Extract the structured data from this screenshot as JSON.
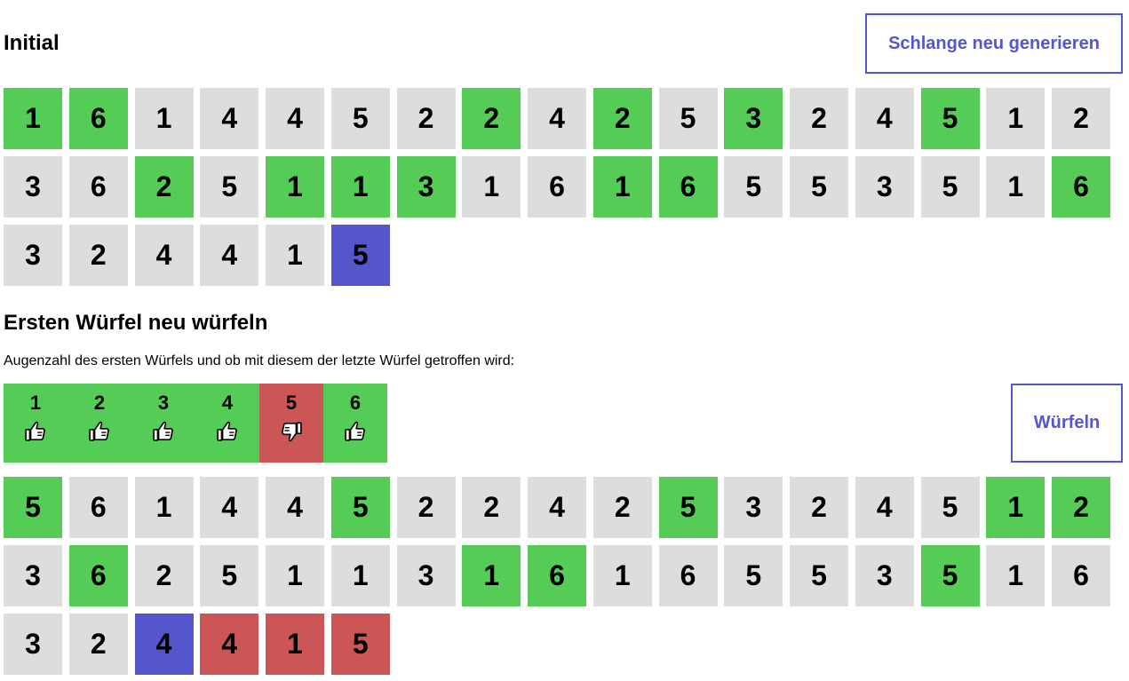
{
  "section1": {
    "title": "Initial",
    "regenerate_label": "Schlange neu generieren",
    "dice": [
      {
        "v": "1",
        "s": "hit"
      },
      {
        "v": "6",
        "s": "hit"
      },
      {
        "v": "1",
        "s": ""
      },
      {
        "v": "4",
        "s": ""
      },
      {
        "v": "4",
        "s": ""
      },
      {
        "v": "5",
        "s": ""
      },
      {
        "v": "2",
        "s": ""
      },
      {
        "v": "2",
        "s": "hit"
      },
      {
        "v": "4",
        "s": ""
      },
      {
        "v": "2",
        "s": "hit"
      },
      {
        "v": "5",
        "s": ""
      },
      {
        "v": "3",
        "s": "hit"
      },
      {
        "v": "2",
        "s": ""
      },
      {
        "v": "4",
        "s": ""
      },
      {
        "v": "5",
        "s": "hit"
      },
      {
        "v": "1",
        "s": ""
      },
      {
        "v": "2",
        "s": ""
      },
      {
        "v": "3",
        "s": ""
      },
      {
        "v": "6",
        "s": ""
      },
      {
        "v": "2",
        "s": "hit"
      },
      {
        "v": "5",
        "s": ""
      },
      {
        "v": "1",
        "s": "hit"
      },
      {
        "v": "1",
        "s": "hit"
      },
      {
        "v": "3",
        "s": "hit"
      },
      {
        "v": "1",
        "s": ""
      },
      {
        "v": "6",
        "s": ""
      },
      {
        "v": "1",
        "s": "hit"
      },
      {
        "v": "6",
        "s": "hit"
      },
      {
        "v": "5",
        "s": ""
      },
      {
        "v": "5",
        "s": ""
      },
      {
        "v": "3",
        "s": ""
      },
      {
        "v": "5",
        "s": ""
      },
      {
        "v": "1",
        "s": ""
      },
      {
        "v": "6",
        "s": "hit"
      },
      {
        "v": "3",
        "s": ""
      },
      {
        "v": "2",
        "s": ""
      },
      {
        "v": "4",
        "s": ""
      },
      {
        "v": "4",
        "s": ""
      },
      {
        "v": "1",
        "s": ""
      },
      {
        "v": "5",
        "s": "cur"
      }
    ]
  },
  "section2": {
    "title": "Ersten Würfel neu würfeln",
    "description": "Augenzahl des ersten Würfels und ob mit diesem der letzte Würfel getroffen wird:",
    "roll_label": "Würfeln",
    "options": [
      {
        "num": "1",
        "result": "thumbs-up"
      },
      {
        "num": "2",
        "result": "thumbs-up"
      },
      {
        "num": "3",
        "result": "thumbs-up"
      },
      {
        "num": "4",
        "result": "thumbs-up"
      },
      {
        "num": "5",
        "result": "thumbs-down"
      },
      {
        "num": "6",
        "result": "thumbs-up"
      }
    ],
    "dice": [
      {
        "v": "5",
        "s": "hit"
      },
      {
        "v": "6",
        "s": ""
      },
      {
        "v": "1",
        "s": ""
      },
      {
        "v": "4",
        "s": ""
      },
      {
        "v": "4",
        "s": ""
      },
      {
        "v": "5",
        "s": "hit"
      },
      {
        "v": "2",
        "s": ""
      },
      {
        "v": "2",
        "s": ""
      },
      {
        "v": "4",
        "s": ""
      },
      {
        "v": "2",
        "s": ""
      },
      {
        "v": "5",
        "s": "hit"
      },
      {
        "v": "3",
        "s": ""
      },
      {
        "v": "2",
        "s": ""
      },
      {
        "v": "4",
        "s": ""
      },
      {
        "v": "5",
        "s": ""
      },
      {
        "v": "1",
        "s": "hit"
      },
      {
        "v": "2",
        "s": "hit"
      },
      {
        "v": "3",
        "s": ""
      },
      {
        "v": "6",
        "s": "hit"
      },
      {
        "v": "2",
        "s": ""
      },
      {
        "v": "5",
        "s": ""
      },
      {
        "v": "1",
        "s": ""
      },
      {
        "v": "1",
        "s": ""
      },
      {
        "v": "3",
        "s": ""
      },
      {
        "v": "1",
        "s": "hit"
      },
      {
        "v": "6",
        "s": "hit"
      },
      {
        "v": "1",
        "s": ""
      },
      {
        "v": "6",
        "s": ""
      },
      {
        "v": "5",
        "s": ""
      },
      {
        "v": "5",
        "s": ""
      },
      {
        "v": "3",
        "s": ""
      },
      {
        "v": "5",
        "s": "hit"
      },
      {
        "v": "1",
        "s": ""
      },
      {
        "v": "6",
        "s": ""
      },
      {
        "v": "3",
        "s": ""
      },
      {
        "v": "2",
        "s": ""
      },
      {
        "v": "4",
        "s": "cur"
      },
      {
        "v": "4",
        "s": "miss"
      },
      {
        "v": "1",
        "s": "miss"
      },
      {
        "v": "5",
        "s": "miss"
      }
    ]
  },
  "colors": {
    "hit": "#55cc55",
    "neutral": "#dddddd",
    "current": "#5555cc",
    "miss": "#cc5555",
    "accent": "#5555cc"
  }
}
